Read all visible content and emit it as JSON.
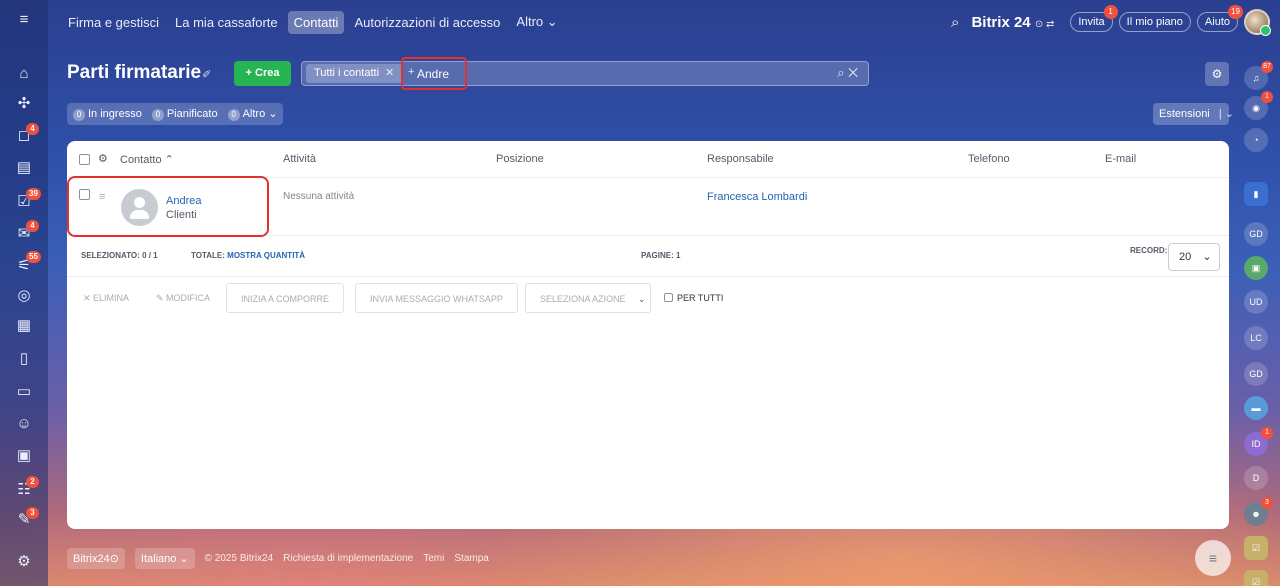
{
  "topnav": {
    "items": [
      "Firma e gestisci",
      "La mia cassaforte",
      "Contatti",
      "Autorizzazioni di accesso",
      "Altro ⌄"
    ],
    "active_index": 2
  },
  "brand": {
    "name": "Bitrix 24",
    "suffix": "⊙ ⇄"
  },
  "top_buttons": {
    "invite": "Invita",
    "invite_badge": "1",
    "plan": "Il mio piano",
    "help": "Aiuto",
    "help_badge": "19"
  },
  "left_badges": [
    "4",
    "39",
    "4",
    "55",
    "2",
    "3"
  ],
  "right_bar": {
    "notif_badge": "87",
    "items": [
      "GD",
      "UD",
      "LC",
      "GD",
      "ID",
      "D"
    ],
    "id_badge": "1",
    "bottom_badge": "3",
    "badge_1": "1"
  },
  "page": {
    "title": "Parti firmatarie",
    "create_label": "+ Crea"
  },
  "search": {
    "filter_tag": "Tutti i contatti",
    "value": "Andre",
    "prefix": "+"
  },
  "counters": [
    {
      "num": "0",
      "label": "In ingresso"
    },
    {
      "num": "0",
      "label": "Pianificato"
    },
    {
      "num": "0",
      "label": "Altro ⌄"
    }
  ],
  "extensions_label": "Estensioni",
  "grid": {
    "columns": [
      "Contatto ⌃",
      "Attività",
      "Posizione",
      "Responsabile",
      "Telefono",
      "E-mail"
    ],
    "rows": [
      {
        "name": "Andrea",
        "type": "Clienti",
        "activity": "Nessuna attività",
        "responsible": "Francesca Lombardi"
      }
    ]
  },
  "footer": {
    "selected_label": "SELEZIONATO:",
    "selected_value": "0 / 1",
    "total_label": "TOTALE:",
    "total_link": "MOSTRA QUANTITÀ",
    "pages": "PAGINE: 1",
    "records_label": "RECORD:",
    "records_value": "20"
  },
  "actions": {
    "delete": "✕  ELIMINA",
    "edit": "✎  MODIFICA",
    "compose": "INIZIA A COMPORRE",
    "whatsapp": "INVIA MESSAGGIO WHATSAPP",
    "select_action": "SELEZIONA AZIONE",
    "for_all": "PER TUTTI"
  },
  "bottom": {
    "brand": "Bitrix24⊙",
    "lang": "Italiano ⌄",
    "copyright": "© 2025 Bitrix24",
    "impl": "Richiesta di implementazione",
    "themes": "Temi",
    "print": "Stampa"
  }
}
